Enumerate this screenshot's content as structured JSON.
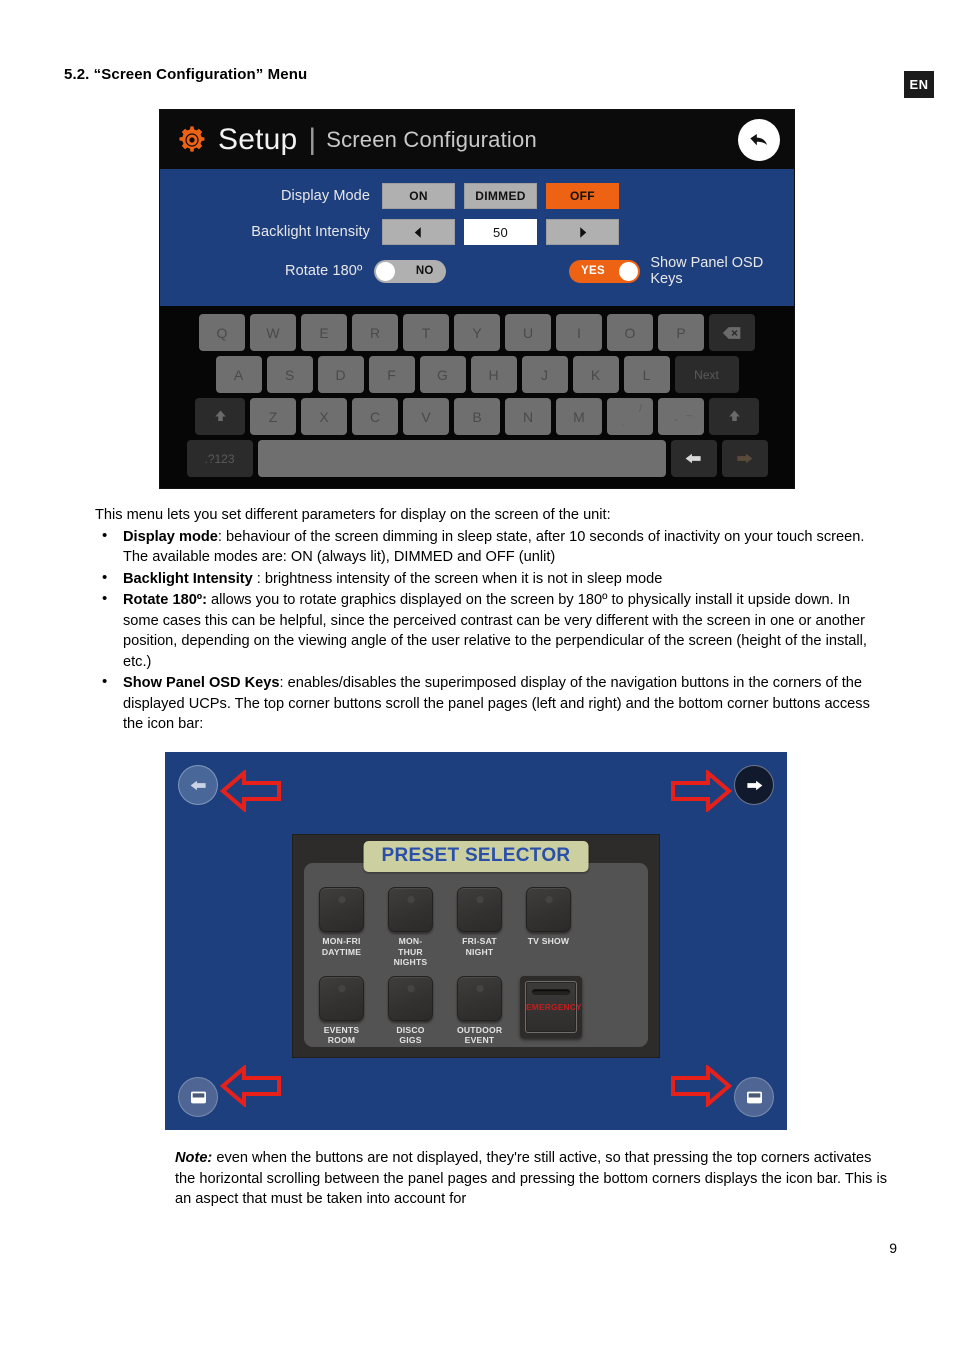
{
  "header": {
    "section_title": "5.2. “Screen Configuration” Menu",
    "language_badge": "EN"
  },
  "setup_screen": {
    "title": "Setup",
    "separator": "|",
    "subtitle": "Screen Configuration",
    "back_icon": "back-arrow-icon",
    "gear_icon": "gear-icon",
    "accent_color": "#ee6214",
    "background_color": "#1e3f7e",
    "rows": [
      {
        "label": "Display Mode",
        "options": [
          "ON",
          "DIMMED",
          "OFF"
        ],
        "selected": "OFF"
      },
      {
        "label": "Backlight Intensity",
        "decrement_icon": "left-arrow-icon",
        "value": "50",
        "increment_icon": "right-arrow-icon"
      }
    ],
    "rotate": {
      "label": "Rotate 180º",
      "value": "NO",
      "state": "off"
    },
    "osd_keys": {
      "label": "Show Panel OSD Keys",
      "value": "YES",
      "state": "on"
    },
    "keyboard": {
      "row1": [
        "Q",
        "W",
        "E",
        "R",
        "T",
        "Y",
        "U",
        "I",
        "O",
        "P"
      ],
      "backspace": "backspace-icon",
      "row2": [
        "A",
        "S",
        "D",
        "F",
        "G",
        "H",
        "J",
        "K",
        "L"
      ],
      "next_key": "Next",
      "row3": [
        "Z",
        "X",
        "C",
        "V",
        "B",
        "N",
        "M"
      ],
      "shift_left_icon": "shift-up-icon",
      "shift_right_icon": "shift-up-icon",
      "period_key_main": ".",
      "period_key_alt": "/",
      "dash_key_main": "-",
      "dash_key_alt": "_",
      "symbols_key": ".?123",
      "space_key": "",
      "prev_field_icon": "left-arrow-icon",
      "next_field_icon": "right-arrow-icon"
    }
  },
  "body": {
    "intro": "This menu lets you set different parameters for display on the screen of the unit:",
    "bullets": [
      {
        "term": "Display mode",
        "text": ": behaviour of the screen dimming in sleep state, after 10 seconds of inactivity on your touch screen. The available modes are: ON (always lit), DIMMED and OFF (unlit)"
      },
      {
        "term": "Backlight Intensity",
        "text": " : brightness intensity of the screen when it is not in sleep mode"
      },
      {
        "term": "Rotate  180º:",
        "text": " allows you to rotate graphics displayed on the screen by 180º to physically install it upside down. In some cases this can be helpful, since the perceived contrast can be very different with the screen in one or another position, depending on the viewing angle of the user relative to the perpendicular of the screen (height of the install, etc.)"
      },
      {
        "term": "Show Panel OSD Keys",
        "text": ": enables/disables the superimposed display of the navigation buttons in the corners of the displayed UCPs. The top corner buttons scroll the panel pages (left and right) and the bottom corner buttons access the icon bar:"
      }
    ]
  },
  "ucp_screen": {
    "background_color": "#1e3f7e",
    "panel_title": "PRESET SELECTOR",
    "panel_title_bg": "#ccd0a0",
    "panel_title_color": "#2a4fa8",
    "osd_top_left_icon": "left-arrow-icon",
    "osd_top_right_icon": "right-arrow-icon",
    "osd_bottom_left_icon": "icon-bar-icon",
    "osd_bottom_right_icon": "icon-bar-icon",
    "annotation_arrows": [
      "red-arrow-left",
      "red-arrow-right",
      "red-arrow-left",
      "red-arrow-right"
    ],
    "presets_row1": [
      {
        "line1": "MON-FRI",
        "line2": "DAYTIME"
      },
      {
        "line1": "MON-THUR",
        "line2": "NIGHTS"
      },
      {
        "line1": "FRI-SAT",
        "line2": "NIGHT"
      },
      {
        "line1": "TV SHOW",
        "line2": ""
      }
    ],
    "presets_row2": [
      {
        "line1": "EVENTS",
        "line2": "ROOM"
      },
      {
        "line1": "DISCO",
        "line2": "GIGS"
      },
      {
        "line1": "OUTDOOR",
        "line2": "EVENT"
      }
    ],
    "emergency": {
      "label": "EMERGENCY",
      "color": "#c01f1f"
    }
  },
  "note": {
    "prefix": "Note:",
    "text": " even when the buttons are not displayed, they're still active, so that pressing the top corners activates the horizontal scrolling between the panel pages and pressing the bottom corners displays the icon bar. This is an aspect that must be taken into account for"
  },
  "footer": {
    "page_number": "9"
  }
}
